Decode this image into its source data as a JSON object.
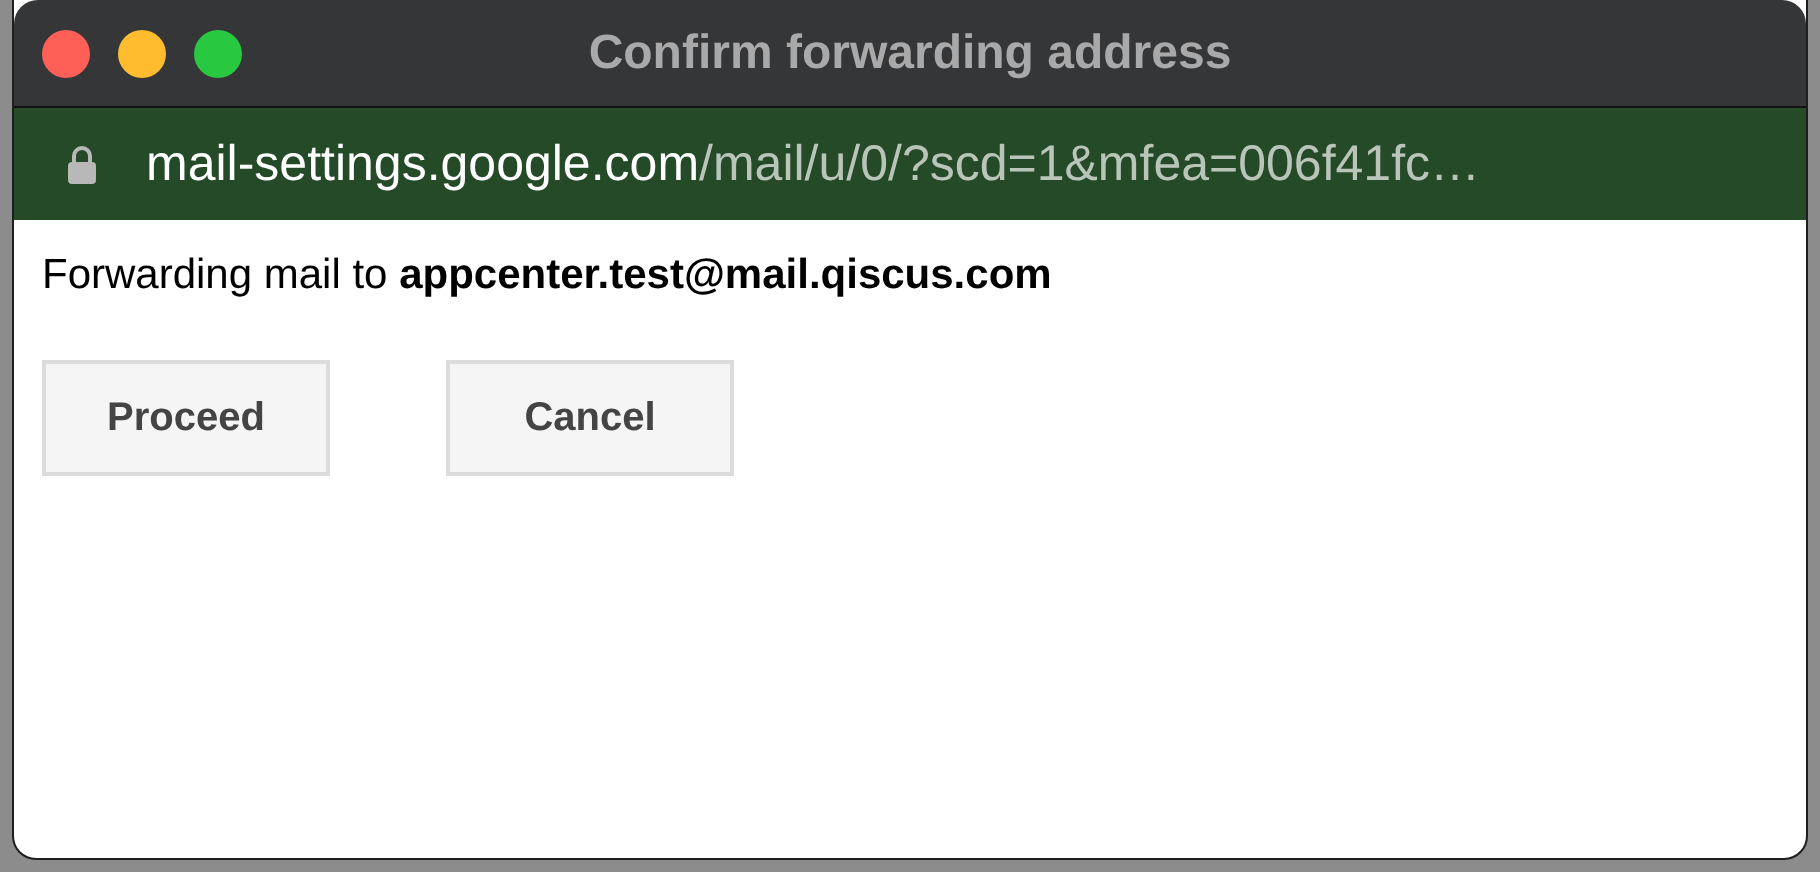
{
  "window": {
    "title": "Confirm forwarding address",
    "traffic_lights": [
      {
        "color": "#fe5f57"
      },
      {
        "color": "#febc2e"
      },
      {
        "color": "#28c840"
      }
    ]
  },
  "address_bar": {
    "host": "mail-settings.google.com",
    "path": "/mail/u/0/?scd=1&mfea=006f41fc…"
  },
  "message": "Forwarding mail to **appcenter.test@mail.qiscus.com**",
  "buttons": [
    "Proceed",
    "Cancel"
  ]
}
